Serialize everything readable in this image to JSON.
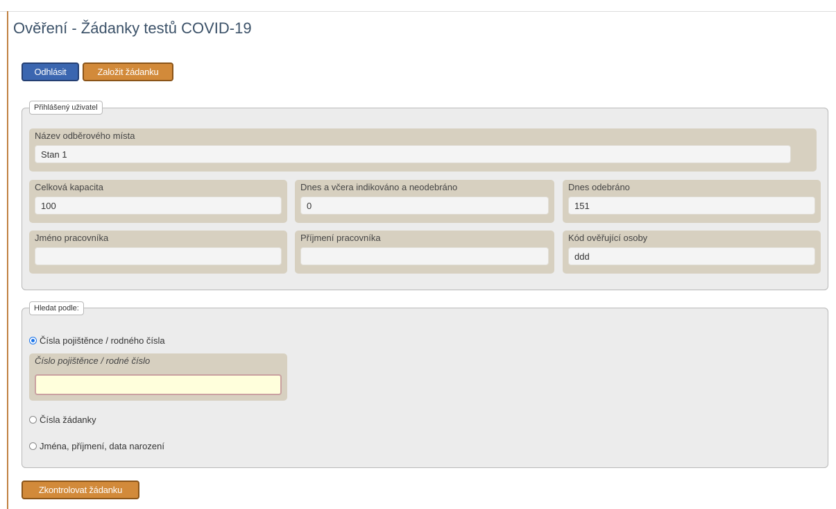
{
  "page": {
    "title": "Ověření - Žádanky testů COVID-19"
  },
  "toolbar": {
    "logout_label": "Odhlásit",
    "create_label": "Založit žádanku"
  },
  "user_panel": {
    "legend": "Přihlášený uživatel",
    "site_name": {
      "label": "Název odběrového místa",
      "value": "Stan 1"
    },
    "total_capacity": {
      "label": "Celková kapacita",
      "value": "100"
    },
    "indicated_not_collected": {
      "label": "Dnes a včera indikováno a neodebráno",
      "value": "0"
    },
    "collected_today": {
      "label": "Dnes odebráno",
      "value": "151"
    },
    "worker_first_name": {
      "label": "Jméno pracovníka",
      "value": ""
    },
    "worker_last_name": {
      "label": "Příjmení pracovníka",
      "value": ""
    },
    "verifier_code": {
      "label": "Kód ověřující osoby",
      "value": "ddd"
    }
  },
  "search_panel": {
    "legend": "Hledat podle:",
    "options": [
      {
        "label": "Čísla pojištěnce / rodného čísla",
        "checked": true
      },
      {
        "label": "Čísla žádanky",
        "checked": false
      },
      {
        "label": "Jména, příjmení, data narození",
        "checked": false
      }
    ],
    "insurance_field": {
      "label": "Číslo pojištěnce / rodné číslo",
      "value": ""
    }
  },
  "actions": {
    "check_label": "Zkontrolovat žádanku"
  }
}
